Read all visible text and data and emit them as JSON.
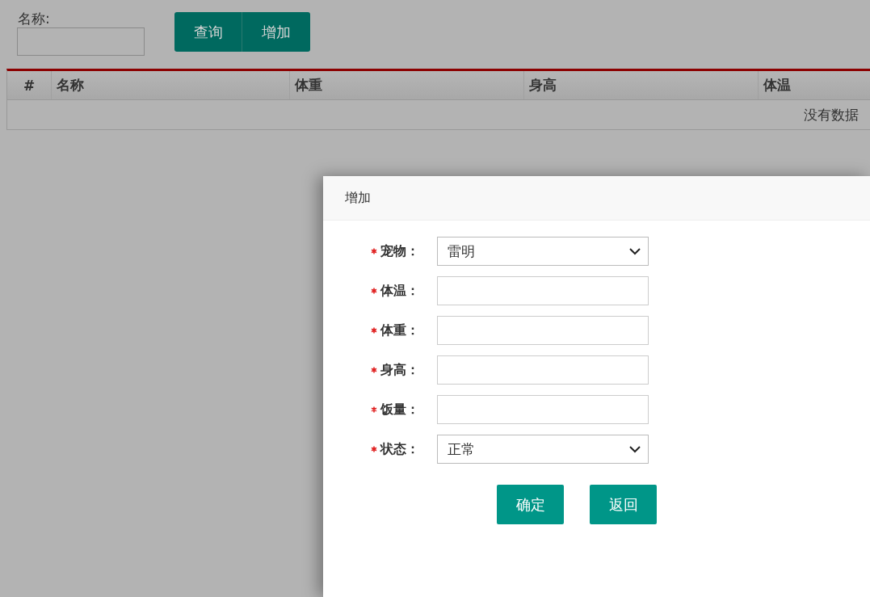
{
  "search": {
    "label": "名称:",
    "buttons": [
      "查询",
      "增加"
    ]
  },
  "table": {
    "columns": [
      "#",
      "名称",
      "体重",
      "身高",
      "体温"
    ],
    "empty_text": "没有数据"
  },
  "dialog": {
    "title": "增加",
    "fields": [
      {
        "kind": "select",
        "label": "宠物：",
        "required": true,
        "value": "雷明"
      },
      {
        "kind": "text",
        "label": "体温：",
        "required": true
      },
      {
        "kind": "text",
        "label": "体重：",
        "required": true
      },
      {
        "kind": "text",
        "label": "身高：",
        "required": true
      },
      {
        "kind": "text",
        "label": "饭量：",
        "required": true
      },
      {
        "kind": "select",
        "label": "状态：",
        "required": true,
        "value": "正常"
      }
    ],
    "buttons": [
      "确定",
      "返回"
    ]
  }
}
